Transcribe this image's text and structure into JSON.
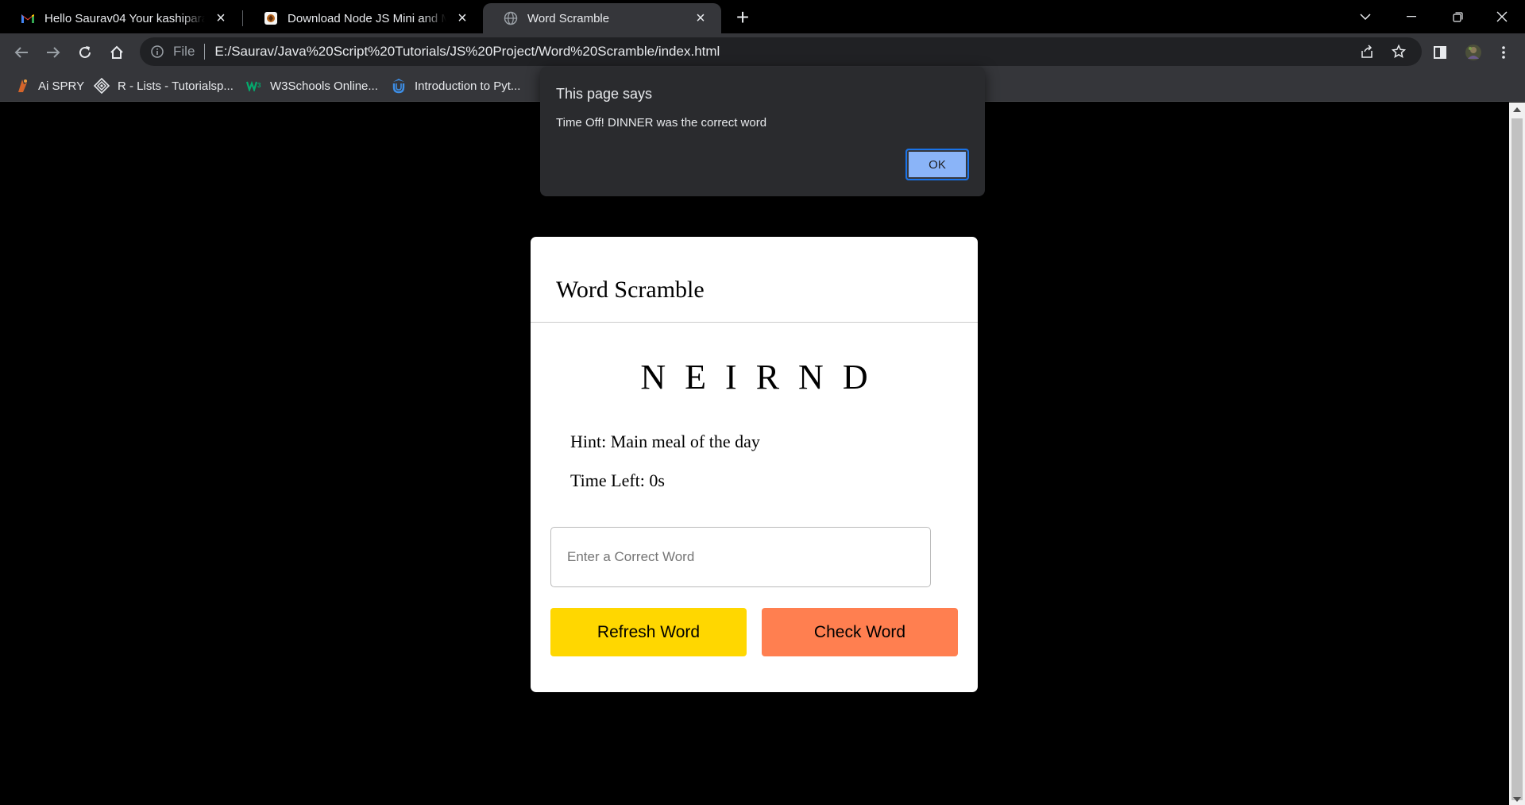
{
  "browser": {
    "tabs": [
      {
        "title": "Hello Saurav04 Your kashipara account",
        "icon": "gmail-icon",
        "active": false
      },
      {
        "title": "Download Node JS Mini and Major Projects",
        "icon": "kashipara-icon",
        "active": false
      },
      {
        "title": "Word Scramble",
        "icon": "globe-icon",
        "active": true
      }
    ],
    "new_tab": "+",
    "address": {
      "scheme": "File",
      "url": "E:/Saurav/Java%20Script%20Tutorials/JS%20Project/Word%20Scramble/index.html"
    },
    "bookmarks": [
      {
        "label": "Ai SPRY",
        "icon": "aispry-icon"
      },
      {
        "label": "R - Lists - Tutorialsp...",
        "icon": "tutorialspoint-icon"
      },
      {
        "label": "W3Schools Online...",
        "icon": "w3schools-icon"
      },
      {
        "label": "Introduction to Pyt...",
        "icon": "udemy-icon"
      }
    ]
  },
  "dialog": {
    "title": "This page says",
    "message": "Time Off! DINNER was the correct word",
    "ok_label": "OK"
  },
  "game": {
    "title": "Word Scramble",
    "scrambled_word": "NEIRND",
    "hint_label": "Hint:",
    "hint_text": "Main meal of the day",
    "time_label": "Time Left:",
    "time_value": "0",
    "time_unit": "s",
    "input_placeholder": "Enter a Correct Word",
    "input_value": "",
    "refresh_label": "Refresh Word",
    "check_label": "Check Word",
    "colors": {
      "refresh_button": "#ffd700",
      "check_button": "#ff7f50",
      "card": "#ffffff",
      "page_background": "#000000"
    }
  }
}
